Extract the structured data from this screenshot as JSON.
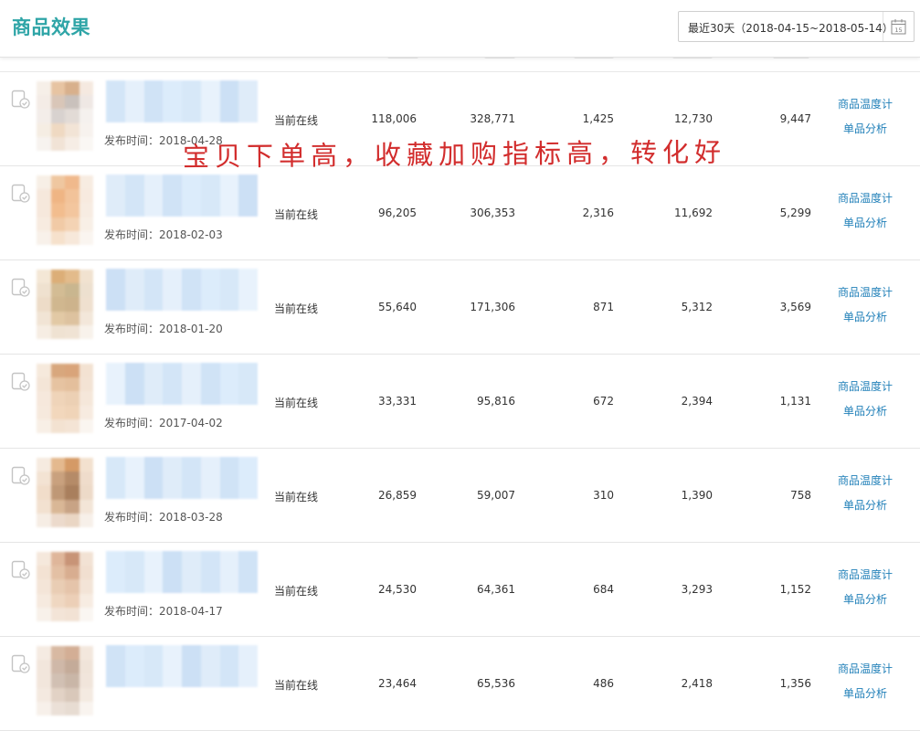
{
  "header": {
    "title": "商品效果",
    "date_range": "最近30天（2018-04-15~2018-05-14）",
    "calendar_day": "15"
  },
  "annotation": "宝贝下单高，收藏加购指标高，转化好",
  "colors": {
    "title": "#2fa5a7",
    "link": "#1f7fb8",
    "annotation": "#d22d2d"
  },
  "rows": [
    {
      "publish": "发布时间：2018-04-28",
      "status": "当前在线",
      "v1": "118,006",
      "v2": "328,771",
      "v3": "1,425",
      "v4": "12,730",
      "v5": "9,447",
      "link1": "商品温度计",
      "link2": "单品分析"
    },
    {
      "publish": "发布时间：2018-02-03",
      "status": "当前在线",
      "v1": "96,205",
      "v2": "306,353",
      "v3": "2,316",
      "v4": "11,692",
      "v5": "5,299",
      "link1": "商品温度计",
      "link2": "单品分析"
    },
    {
      "publish": "发布时间：2018-01-20",
      "status": "当前在线",
      "v1": "55,640",
      "v2": "171,306",
      "v3": "871",
      "v4": "5,312",
      "v5": "3,569",
      "link1": "商品温度计",
      "link2": "单品分析"
    },
    {
      "publish": "发布时间：2017-04-02",
      "status": "当前在线",
      "v1": "33,331",
      "v2": "95,816",
      "v3": "672",
      "v4": "2,394",
      "v5": "1,131",
      "link1": "商品温度计",
      "link2": "单品分析"
    },
    {
      "publish": "发布时间：2018-03-28",
      "status": "当前在线",
      "v1": "26,859",
      "v2": "59,007",
      "v3": "310",
      "v4": "1,390",
      "v5": "758",
      "link1": "商品温度计",
      "link2": "单品分析"
    },
    {
      "publish": "发布时间：2018-04-17",
      "status": "当前在线",
      "v1": "24,530",
      "v2": "64,361",
      "v3": "684",
      "v4": "3,293",
      "v5": "1,152",
      "link1": "商品温度计",
      "link2": "单品分析"
    },
    {
      "publish": "",
      "status": "当前在线",
      "v1": "23,464",
      "v2": "65,536",
      "v3": "486",
      "v4": "2,418",
      "v5": "1,356",
      "link1": "商品温度计",
      "link2": "单品分析"
    }
  ]
}
